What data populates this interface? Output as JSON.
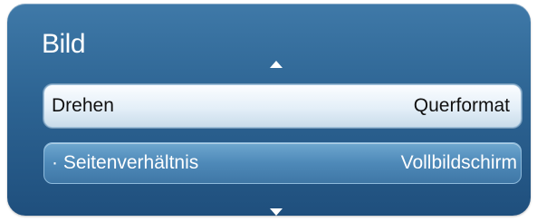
{
  "menu": {
    "title": "Bild",
    "items": [
      {
        "label": "Drehen",
        "value": "Querformat"
      },
      {
        "label": "· Seitenverhältnis",
        "value": "Vollbildschirm"
      }
    ]
  },
  "icons": {
    "scroll_up": "triangle-up",
    "scroll_down": "triangle-down"
  },
  "colors": {
    "panel": "#2d6493",
    "selected_row": "#e4eff8",
    "row": "#4e89b8",
    "text_light": "#ffffff",
    "text_dark": "#111111"
  }
}
